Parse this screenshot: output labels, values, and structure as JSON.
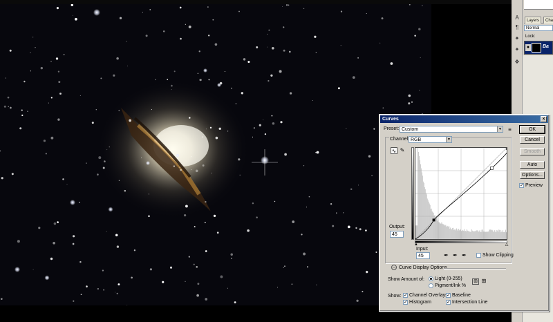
{
  "layers_panel": {
    "tabs": [
      "Layers",
      "Cha"
    ],
    "blend_mode": "Normal",
    "lock_label": "Lock:",
    "layer_name": "Ba"
  },
  "tools": [
    "A",
    "¶",
    "✦",
    "✦",
    "❖"
  ],
  "curves": {
    "title": "Curves",
    "preset_label": "Preset:",
    "preset_value": "Custom",
    "channel_label": "Channel:",
    "channel_value": "RGB",
    "output_label": "Output:",
    "output_value": "45",
    "input_label": "Input:",
    "input_value": "45",
    "show_clipping_label": "Show Clipping",
    "display_options_label": "Curve Display Options",
    "show_amount_label": "Show Amount of:",
    "light_label": "Light  (0-255)",
    "pigment_label": "Pigment/Ink %",
    "show_label": "Show:",
    "channel_overlays_label": "Channel Overlays",
    "baseline_label": "Baseline",
    "histogram_label": "Histogram",
    "intersection_label": "Intersection Line",
    "buttons": {
      "ok": "OK",
      "cancel": "Cancel",
      "smooth": "Smooth",
      "auto": "Auto",
      "options": "Options..."
    },
    "preview_label": "Preview",
    "preview_checked": true,
    "show_clipping_checked": false,
    "channel_overlays_checked": true,
    "baseline_checked": true,
    "histogram_checked": true,
    "intersection_checked": true,
    "light_selected": true
  },
  "colors": {
    "title_bar": "#0a246a",
    "dialog_bg": "#d4d0c8"
  }
}
